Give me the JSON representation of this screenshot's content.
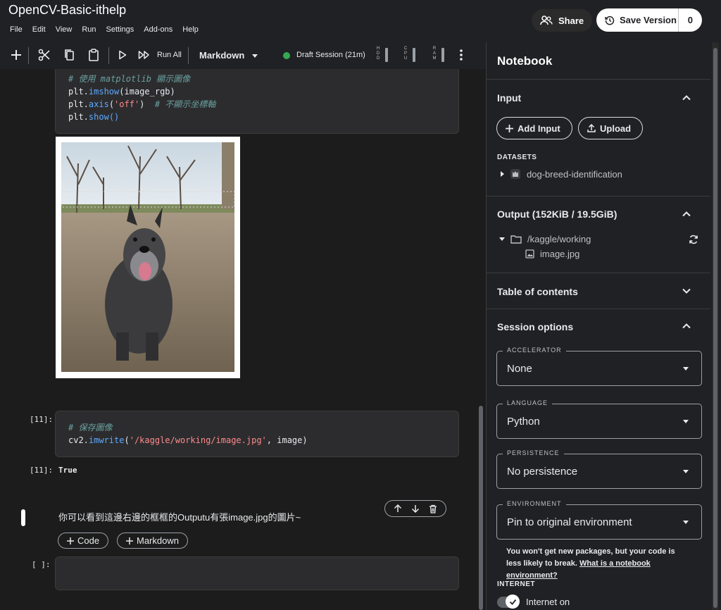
{
  "app": {
    "title": "OpenCV-Basic-ithelp"
  },
  "menu": [
    "File",
    "Edit",
    "View",
    "Run",
    "Settings",
    "Add-ons",
    "Help"
  ],
  "header": {
    "share_label": "Share",
    "save_version_label": "Save Version",
    "save_count": "0"
  },
  "toolbar": {
    "run_all_label": "Run All",
    "cell_type": "Markdown",
    "session_label": "Draft Session (21m)",
    "session_status_color": "#34a853",
    "metrics": [
      "HDD",
      "CPU",
      "RAM"
    ]
  },
  "cells": {
    "code1": {
      "comment1": "# 使用 matplotlib 顯示圖像",
      "line1_prefix": "plt.",
      "line1_fn": "imshow",
      "line1_rest": "(image_rgb)",
      "line2_prefix": "plt.",
      "line2_fn": "axis",
      "line2_str": "'off'",
      "line2_comment": "# 不顯示坐標軸",
      "line3_prefix": "plt.",
      "line3_fn": "show",
      "line3_rest": "()"
    },
    "code2": {
      "prompt": "[11]:",
      "comment": "# 保存圖像",
      "line_prefix": "cv2.",
      "line_fn": "imwrite",
      "line_str": "'/kaggle/working/image.jpg'",
      "line_rest": ", image)",
      "output_prompt": "[11]:",
      "output_value": "True"
    },
    "markdown": {
      "text": "你可以看到這邊右邊的框框的Outputu有張image.jpg的圖片~"
    },
    "add_code_label": "Code",
    "add_markdown_label": "Markdown",
    "empty_prompt": "[ ]:"
  },
  "panel": {
    "title": "Notebook",
    "input": {
      "header": "Input",
      "add_input_label": "Add Input",
      "upload_label": "Upload",
      "datasets_label": "DATASETS",
      "dataset_name": "dog-breed-identification"
    },
    "output": {
      "header": "Output (152KiB / 19.5GiB)",
      "folder": "/kaggle/working",
      "file": "image.jpg"
    },
    "toc": {
      "header": "Table of contents"
    },
    "session": {
      "header": "Session options",
      "accelerator": {
        "label": "ACCELERATOR",
        "value": "None"
      },
      "language": {
        "label": "LANGUAGE",
        "value": "Python"
      },
      "persistence": {
        "label": "PERSISTENCE",
        "value": "No persistence"
      },
      "environment": {
        "label": "ENVIRONMENT",
        "value": "Pin to original environment"
      },
      "env_note": "You won't get new packages, but your code is less likely to break.",
      "env_link": "What is a notebook environment?",
      "internet_label": "INTERNET",
      "internet_value": "Internet on"
    }
  }
}
